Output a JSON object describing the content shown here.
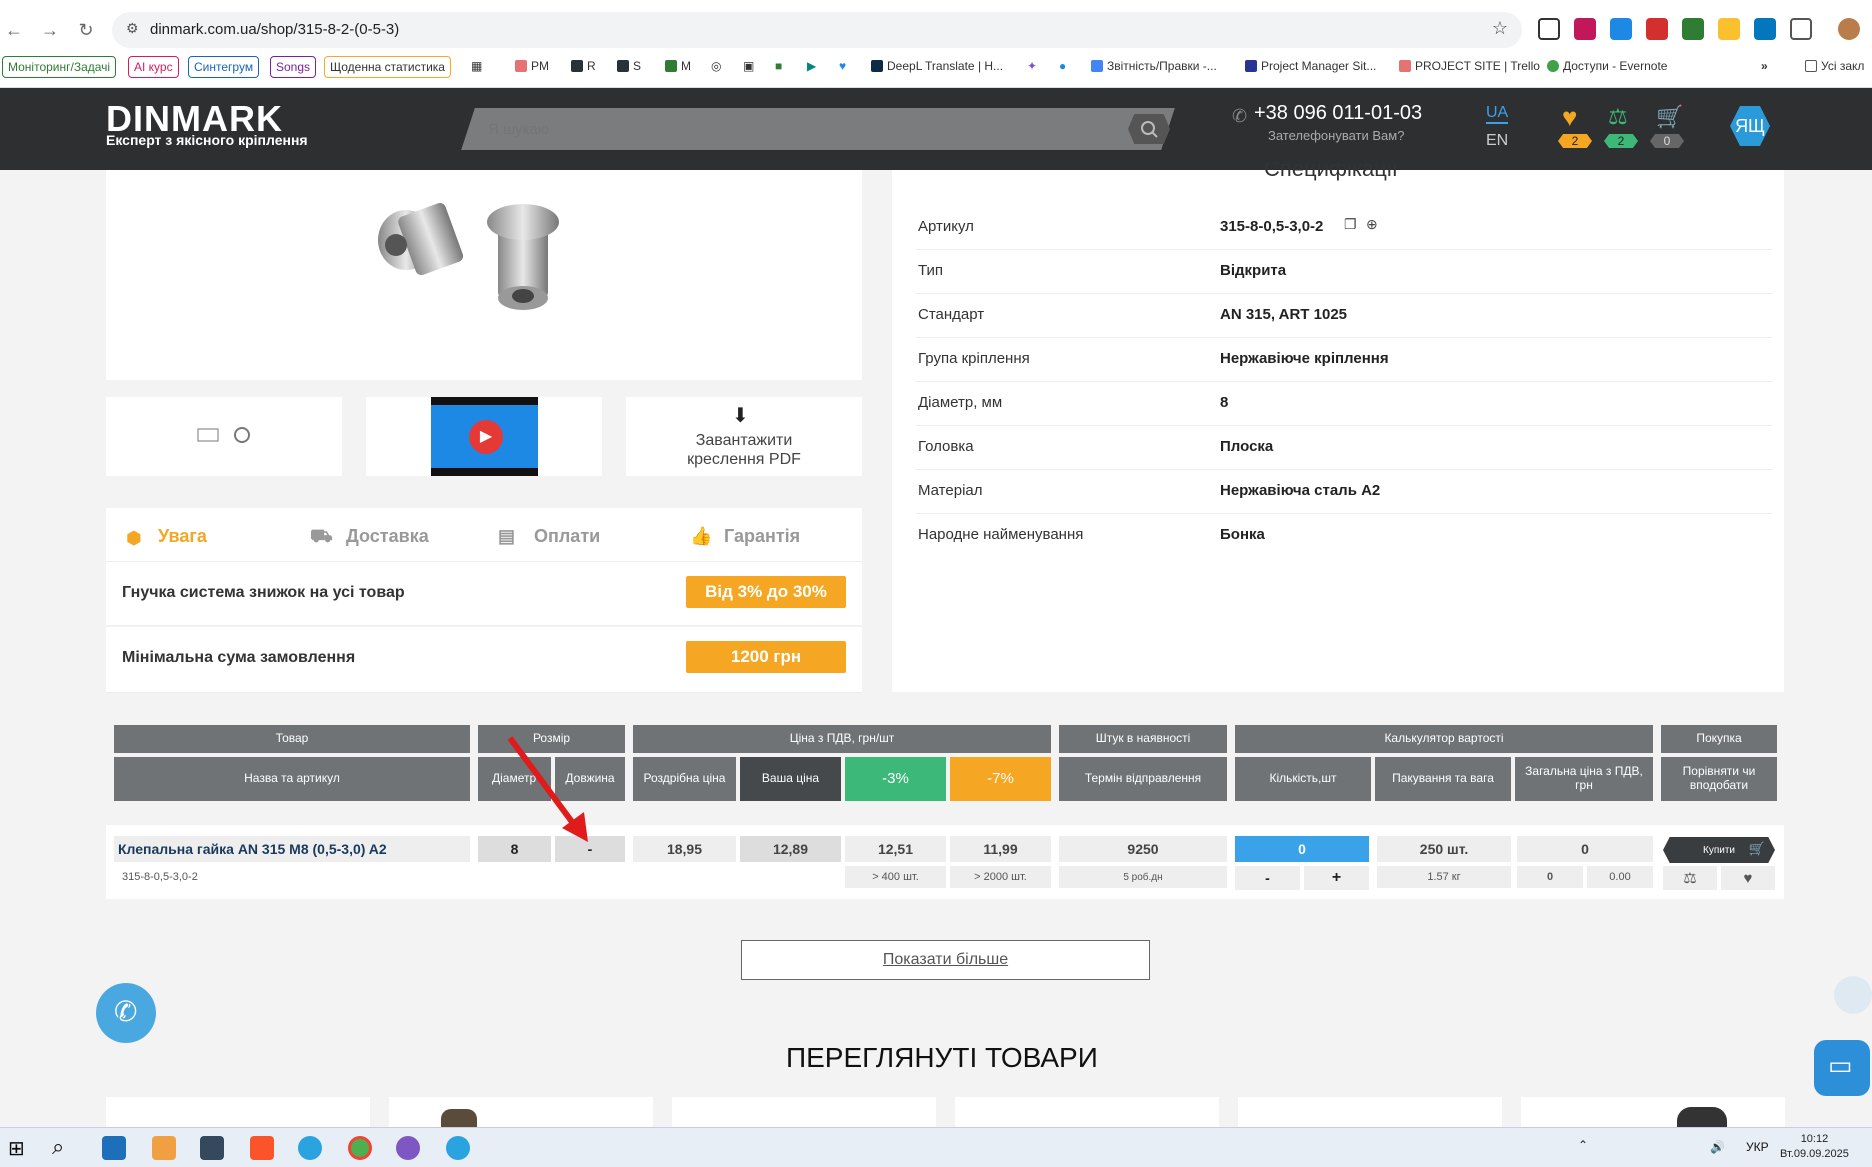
{
  "browser": {
    "url": "dinmark.com.ua/shop/315-8-2-(0-5-3)",
    "bookmarks": [
      "Моніторинг/Задачі",
      "AI курс",
      "Синтегрум",
      "Songs",
      "Щоденна статистика",
      "PM",
      "R",
      "S",
      "M",
      "DeepL Translate | H...",
      "Звітність/Правки -...",
      "Project Manager Sit...",
      "PROJECT SITE | Trello",
      "Доступи - Evernote",
      "Усі закл"
    ]
  },
  "header": {
    "logo": "DINMARK",
    "tagline": "Експерт з якісного кріплення",
    "search_placeholder": "Я шукаю",
    "phone": "+38 096 011-01-03",
    "callback": "Зателефонувати Вам?",
    "lang_active": "UA",
    "lang_other": "EN",
    "favorites_count": "2",
    "compare_count": "2",
    "cart_count": "0",
    "avatar": "ЯЩ"
  },
  "specs": {
    "title": "Специфікації",
    "rows": [
      {
        "label": "Артикул",
        "value": "315-8-0,5-3,0-2"
      },
      {
        "label": "Тип",
        "value": "Відкрита"
      },
      {
        "label": "Стандарт",
        "value": "AN 315, ART 1025"
      },
      {
        "label": "Група кріплення",
        "value": "Нержавіюче кріплення"
      },
      {
        "label": "Діаметр, мм",
        "value": "8"
      },
      {
        "label": "Головка",
        "value": "Плоска"
      },
      {
        "label": "Матеріал",
        "value": "Нержавіюча сталь A2"
      },
      {
        "label": "Народне найменування",
        "value": "Бонка"
      }
    ]
  },
  "media": {
    "pdf_label": "Завантажити креслення PDF"
  },
  "tabs": [
    "Увага",
    "Доставка",
    "Оплати",
    "Гарантія"
  ],
  "promo": [
    {
      "label": "Гнучка система знижок на усі товар",
      "badge": "Від 3% до 30%"
    },
    {
      "label": "Мінімальна сума замовлення",
      "badge": "1200 грн"
    }
  ],
  "table": {
    "groups": [
      "Товар",
      "Розмір",
      "Ціна з ПДВ, грн/шт",
      "Штук в наявності",
      "Калькулятор вартості",
      "Покупка"
    ],
    "cols": [
      "Назва та артикул",
      "Діаметр",
      "Довжина",
      "Роздрібна ціна",
      "Ваша ціна",
      "-3%",
      "-7%",
      "Термін відправлення",
      "Кількість,шт",
      "Пакування та вага",
      "Загальна ціна з ПДВ, грн",
      "Порівняти чи вподобати"
    ],
    "row": {
      "name": "Клепальна гайка AN 315 M8 (0,5-3,0) A2",
      "sku": "315-8-0,5-3,0-2",
      "diameter": "8",
      "length": "-",
      "retail": "18,95",
      "your_price": "12,89",
      "p3": "12,51",
      "p3_min": "> 400 шт.",
      "p7": "11,99",
      "p7_min": "> 2000 шт.",
      "stock": "9250",
      "ship": "5 роб.дн",
      "qty": "0",
      "minus": "-",
      "plus": "+",
      "pack": "250 шт.",
      "weight": "1.57 кг",
      "total": "0",
      "total_a": "0",
      "total_b": "0.00",
      "buy": "Купити"
    }
  },
  "show_more": "Показати більше",
  "viewed_title": "ПЕРЕГЛЯНУТІ ТОВАРИ",
  "taskbar": {
    "lang": "УКР",
    "time": "10:12",
    "date": "Вт.09.09.2025"
  },
  "colors": {
    "accent_orange": "#f5a623",
    "accent_green": "#3cb878",
    "accent_blue": "#39a2e8",
    "header_dark": "#2d2f31"
  }
}
